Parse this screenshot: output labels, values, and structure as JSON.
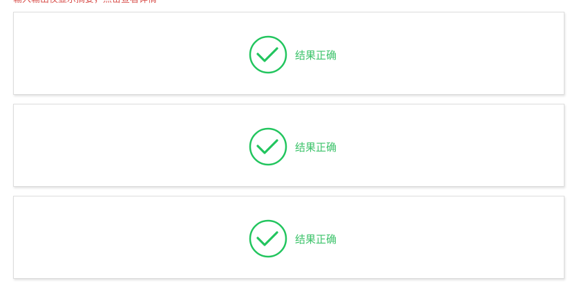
{
  "notice": "输入输出仅显示摘要，点击查看详情",
  "accent_color": "#22c55e",
  "notice_color": "#d9534f",
  "results": [
    {
      "icon": "check-circle-icon",
      "text": "结果正确"
    },
    {
      "icon": "check-circle-icon",
      "text": "结果正确"
    },
    {
      "icon": "check-circle-icon",
      "text": "结果正确"
    }
  ]
}
